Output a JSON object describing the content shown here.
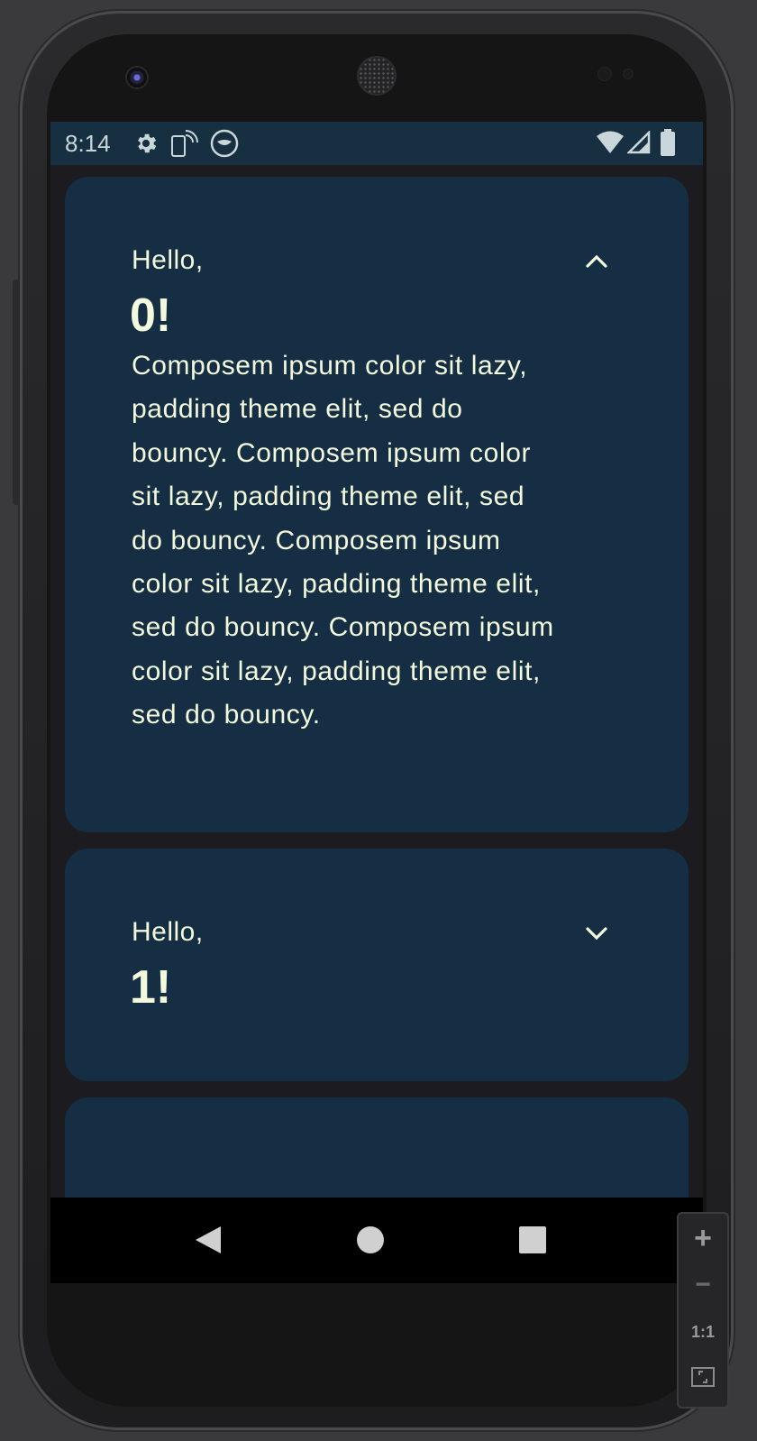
{
  "status_bar": {
    "time": "8:14",
    "icons": [
      "gear-icon",
      "phone-wifi-icon",
      "mute-icon",
      "wifi-icon",
      "signal-icon",
      "battery-icon"
    ]
  },
  "cards": [
    {
      "greeting": "Hello,",
      "name": "0!",
      "expanded": true,
      "chevron": "chevron-up-icon",
      "body": "Composem ipsum color sit lazy, padding theme elit, sed do bouncy. Composem ipsum color sit lazy, padding theme elit, sed do bouncy. Composem ipsum color sit lazy, padding theme elit, sed do bouncy. Composem ipsum color sit lazy, padding theme elit, sed do bouncy."
    },
    {
      "greeting": "Hello,",
      "name": "1!",
      "expanded": false,
      "chevron": "chevron-down-icon"
    },
    {
      "greeting": "",
      "name": "",
      "expanded": false
    }
  ],
  "nav_bar": {
    "icons": [
      "back-icon",
      "home-icon",
      "recents-icon"
    ]
  },
  "zoom_controls": {
    "plus": "+",
    "minus": "−",
    "one_to_one": "1:1",
    "icons": [
      "zoom-in-icon",
      "zoom-out-icon",
      "fit-screen-icon"
    ]
  },
  "colors": {
    "card_background": "#162e43",
    "card_text": "#f3f9dd",
    "screen_background": "#1c1b1f",
    "status_bar": "#163042"
  }
}
